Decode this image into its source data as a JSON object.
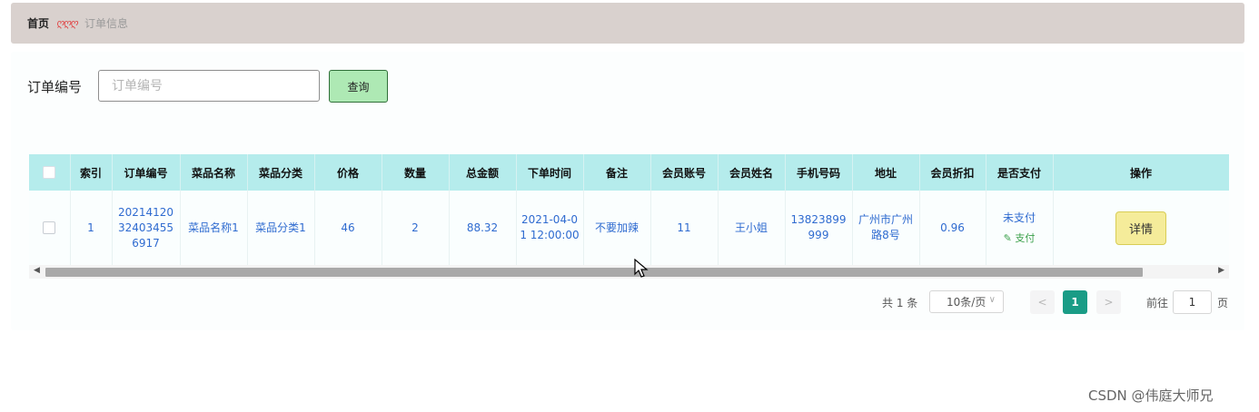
{
  "breadcrumb": {
    "home": "首页",
    "separator": "ღღღ",
    "current": "订单信息"
  },
  "search": {
    "label": "订单编号",
    "placeholder": "订单编号",
    "value": "",
    "button": "查询"
  },
  "table": {
    "headers": [
      "索引",
      "订单编号",
      "菜品名称",
      "菜品分类",
      "价格",
      "数量",
      "总金额",
      "下单时间",
      "备注",
      "会员账号",
      "会员姓名",
      "手机号码",
      "地址",
      "会员折扣",
      "是否支付",
      "操作"
    ],
    "rows": [
      {
        "index": "1",
        "order_no": "20214120324034556917",
        "dish_name": "菜品名称1",
        "dish_category": "菜品分类1",
        "price": "46",
        "quantity": "2",
        "total": "88.32",
        "order_time": "2021-04-01 12:00:00",
        "remark": "不要加辣",
        "member_account": "11",
        "member_name": "王小姐",
        "phone": "13823899999",
        "address": "广州市广州路8号",
        "discount": "0.96",
        "pay_status": "未支付",
        "pay_action": "支付",
        "detail_button": "详情"
      }
    ]
  },
  "pagination": {
    "total_text": "共 1 条",
    "page_size": "10条/页",
    "current_page": "1",
    "goto_label": "前往",
    "goto_value": "1",
    "page_unit": "页"
  },
  "watermark": "CSDN @伟庭大师兄",
  "colors": {
    "header_bg": "#b5ecec",
    "query_button": "#aee9b4",
    "detail_button": "#f5ec9a",
    "active_page": "#1a9c86",
    "breadcrumb_bg": "#d9d1ce"
  }
}
